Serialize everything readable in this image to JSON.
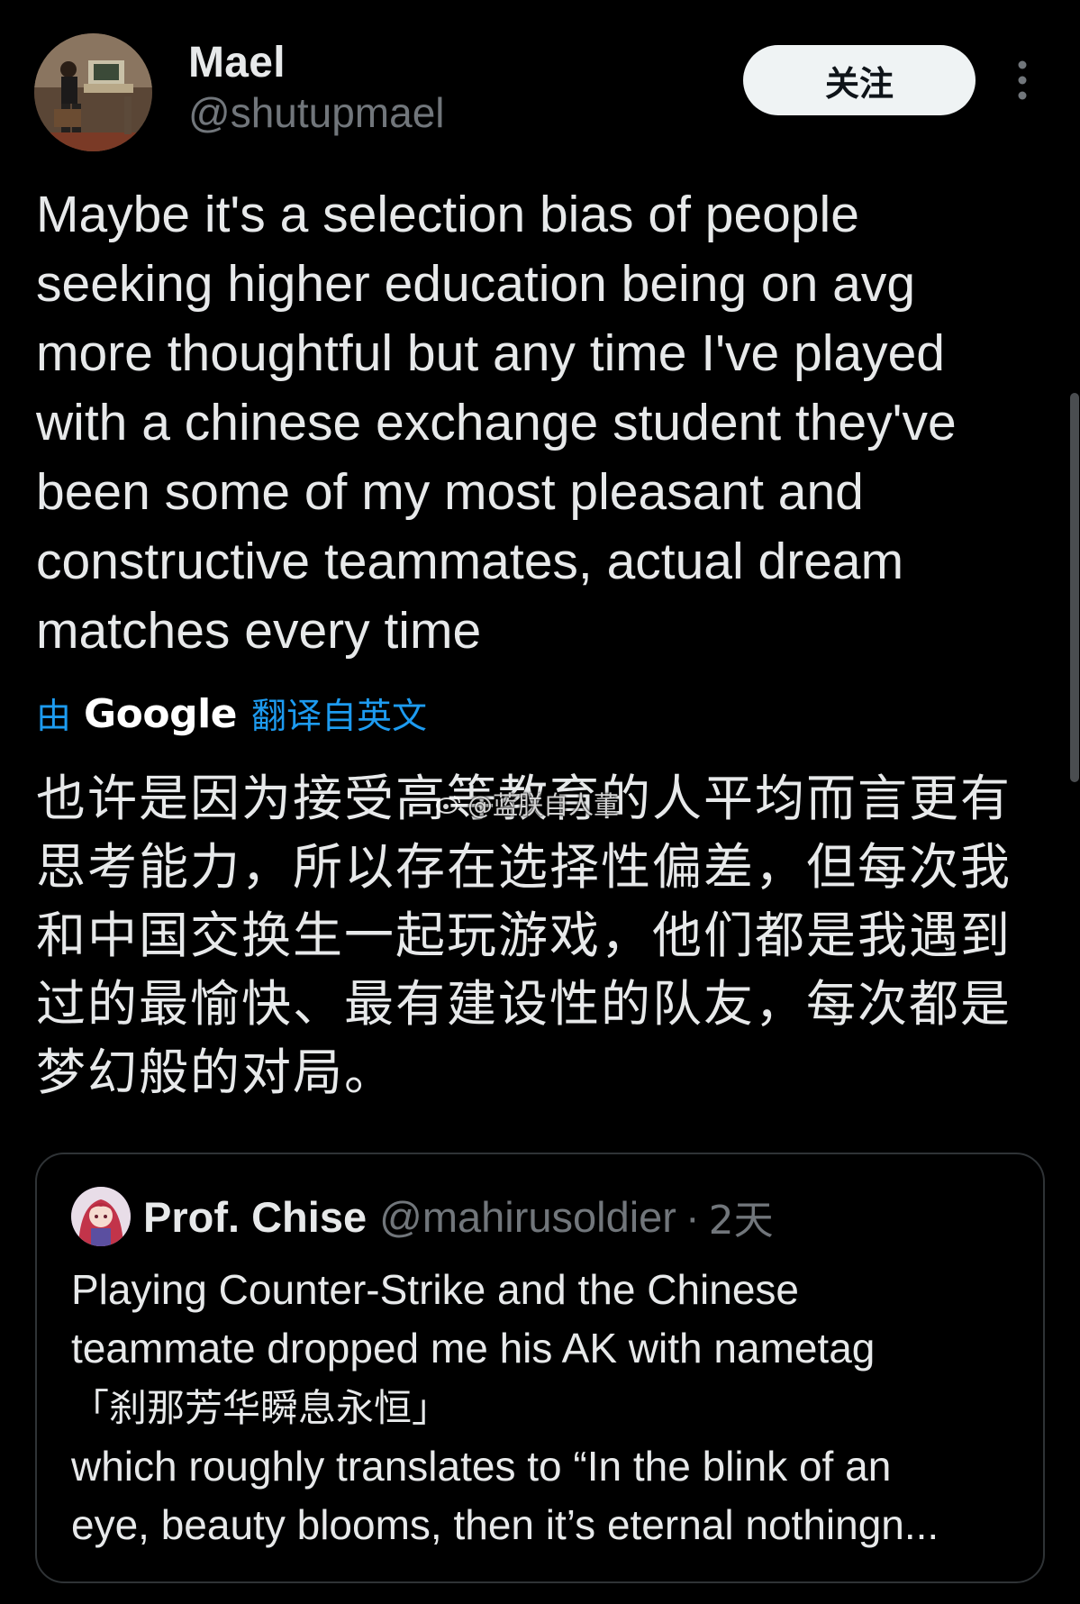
{
  "author": {
    "name": "Mael",
    "handle": "@shutupmael"
  },
  "header": {
    "follow_label": "关注",
    "more_icon": "more-vertical-icon"
  },
  "tweet": {
    "text": "Maybe it's a selection bias of people\nseeking higher education being on avg\nmore thoughtful but any time I've played\nwith a chinese exchange student they've\nbeen some of my most pleasant and\nconstructive teammates, actual dream\nmatches every time",
    "translate_by": "由",
    "translate_brand": "Google",
    "translate_link": "翻译自英文",
    "translated_text": "也许是因为接受高等教育的人平均而言更有思考能力，所以存在选择性偏差，但每次我和中国交换生一起玩游戏，他们都是我遇到过的最愉快、最有建设性的队友，每次都是梦幻般的对局。"
  },
  "watermark": {
    "text": "@蓝朕自人董",
    "icon": "weibo-logo-icon"
  },
  "quote": {
    "name": "Prof. Chise",
    "handle": "@mahirusoldier",
    "separator": "·",
    "time": "2天",
    "line1": "Playing Counter-Strike and the Chinese\nteammate dropped me his AK with nametag",
    "line2": "「刹那芳华瞬息永恒」",
    "line3": "which roughly translates to “In the blink of an\neye, beauty blooms, then it’s eternal nothingn..."
  },
  "colors": {
    "background": "#000000",
    "text": "#e7e9ea",
    "secondary": "#71767b",
    "link": "#1d9bf0",
    "border": "#2f3336",
    "follow_bg": "#eff3f4"
  }
}
